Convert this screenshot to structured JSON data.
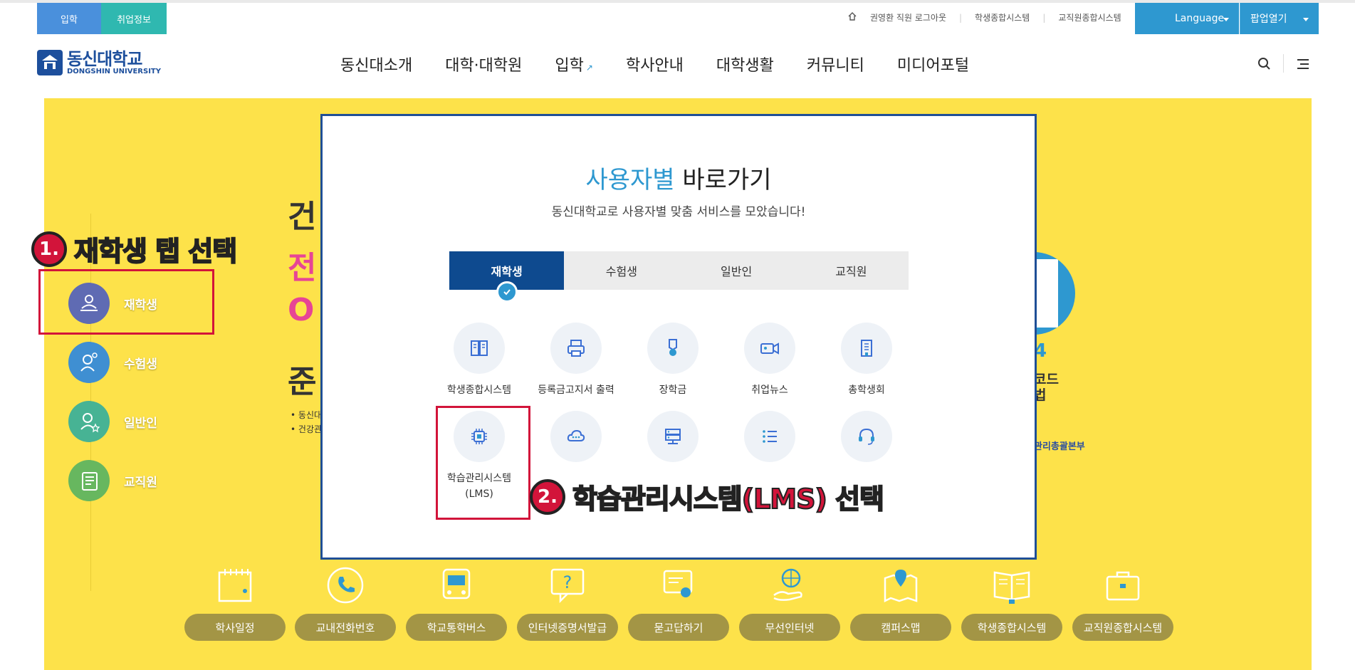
{
  "top": {
    "quick_tabs": [
      "입학",
      "취업정보"
    ],
    "user_links": [
      "권영환 직원 로그아웃",
      "학생종합시스템",
      "교직원종합시스템"
    ],
    "language_label": "Language",
    "popup_label": "팝업열기"
  },
  "header": {
    "logo_korean": "동신대학교",
    "logo_english": "DONGSHIN UNIVERSITY",
    "nav": [
      "동신대소개",
      "대학·대학원",
      "입학",
      "학사안내",
      "대학생활",
      "커뮤니티",
      "미디어포털"
    ]
  },
  "sidebar": {
    "items": [
      {
        "label": "재학생",
        "color": "#5f6bb3"
      },
      {
        "label": "수험생",
        "color": "#3f8fd2"
      },
      {
        "label": "일반인",
        "color": "#47b394"
      },
      {
        "label": "교직원",
        "color": "#67b75f"
      }
    ]
  },
  "background": {
    "partial_chars": [
      "건",
      "전",
      "O",
      "준"
    ],
    "bullets": [
      "동신대",
      "건강관"
    ],
    "right_fragments": [
      "4",
      "코드",
      "법",
      "관리총괄본부"
    ]
  },
  "annotations": {
    "step1_num": "1.",
    "step1_text": "재학생 탭 선택",
    "step2_num": "2.",
    "step2_text": "학습관리시스템(LMS) 선택"
  },
  "modal": {
    "title_highlight": "사용자별",
    "title_rest": " 바로가기",
    "subtitle": "동신대학교로 사용자별 맞춤 서비스를 모았습니다!",
    "tabs": [
      "재학생",
      "수험생",
      "일반인",
      "교직원"
    ],
    "active_tab": "재학생",
    "items": [
      {
        "label": "학생종합시스템",
        "icon": "book-icon"
      },
      {
        "label": "등록금고지서 출력",
        "icon": "printer-icon"
      },
      {
        "label": "장학금",
        "icon": "medal-icon"
      },
      {
        "label": "취업뉴스",
        "icon": "video-camera-icon"
      },
      {
        "label": "총학생회",
        "icon": "building-icon"
      },
      {
        "label": "학습관리시스템\n(LMS)",
        "icon": "chip-icon"
      },
      {
        "label": "",
        "icon": "cloud-icon"
      },
      {
        "label": "",
        "icon": "server-icon"
      },
      {
        "label": "",
        "icon": "list-icon"
      },
      {
        "label": "",
        "icon": "headset-icon"
      }
    ]
  },
  "quick_menu": [
    "학사일정",
    "교내전화번호",
    "학교통학버스",
    "인터넷증명서발급",
    "묻고답하기",
    "무선인터넷",
    "캠퍼스맵",
    "학생종합시스템",
    "교직원종합시스템"
  ],
  "colors": {
    "accent_blue": "#2e98d0",
    "navy": "#0e4a8f",
    "yellow_bg": "#fde24a",
    "annotation_red": "#d2143a",
    "quick_button": "#a39545"
  }
}
